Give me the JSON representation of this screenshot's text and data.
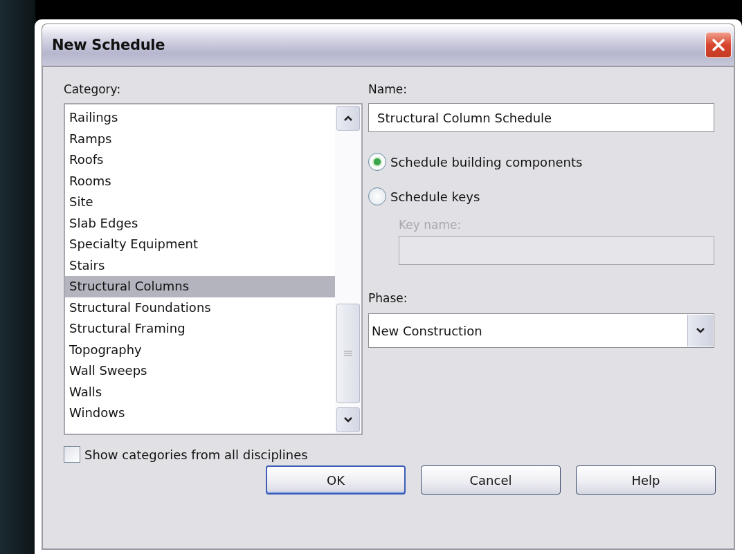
{
  "window": {
    "title": "New Schedule"
  },
  "category": {
    "label": "Category:",
    "items": [
      {
        "label": "Railings",
        "selected": false
      },
      {
        "label": "Ramps",
        "selected": false
      },
      {
        "label": "Roofs",
        "selected": false
      },
      {
        "label": "Rooms",
        "selected": false
      },
      {
        "label": "Site",
        "selected": false
      },
      {
        "label": "Slab Edges",
        "selected": false
      },
      {
        "label": "Specialty Equipment",
        "selected": false
      },
      {
        "label": "Stairs",
        "selected": false
      },
      {
        "label": "Structural Columns",
        "selected": true
      },
      {
        "label": "Structural Foundations",
        "selected": false
      },
      {
        "label": "Structural Framing",
        "selected": false
      },
      {
        "label": "Topography",
        "selected": false
      },
      {
        "label": "Wall Sweeps",
        "selected": false
      },
      {
        "label": "Walls",
        "selected": false
      },
      {
        "label": "Windows",
        "selected": false
      }
    ]
  },
  "show_all": {
    "label": "Show categories from all disciplines",
    "checked": false
  },
  "name": {
    "label": "Name:",
    "value": "Structural Column Schedule"
  },
  "options": [
    {
      "label": "Schedule building components",
      "selected": true
    },
    {
      "label": "Schedule keys",
      "selected": false
    }
  ],
  "key_name": {
    "label": "Key name:",
    "disabled": true
  },
  "phase": {
    "label": "Phase:",
    "value": "New Construction"
  },
  "buttons": [
    {
      "label": "OK",
      "default": true
    },
    {
      "label": "Cancel",
      "default": false
    },
    {
      "label": "Help",
      "default": false
    }
  ]
}
